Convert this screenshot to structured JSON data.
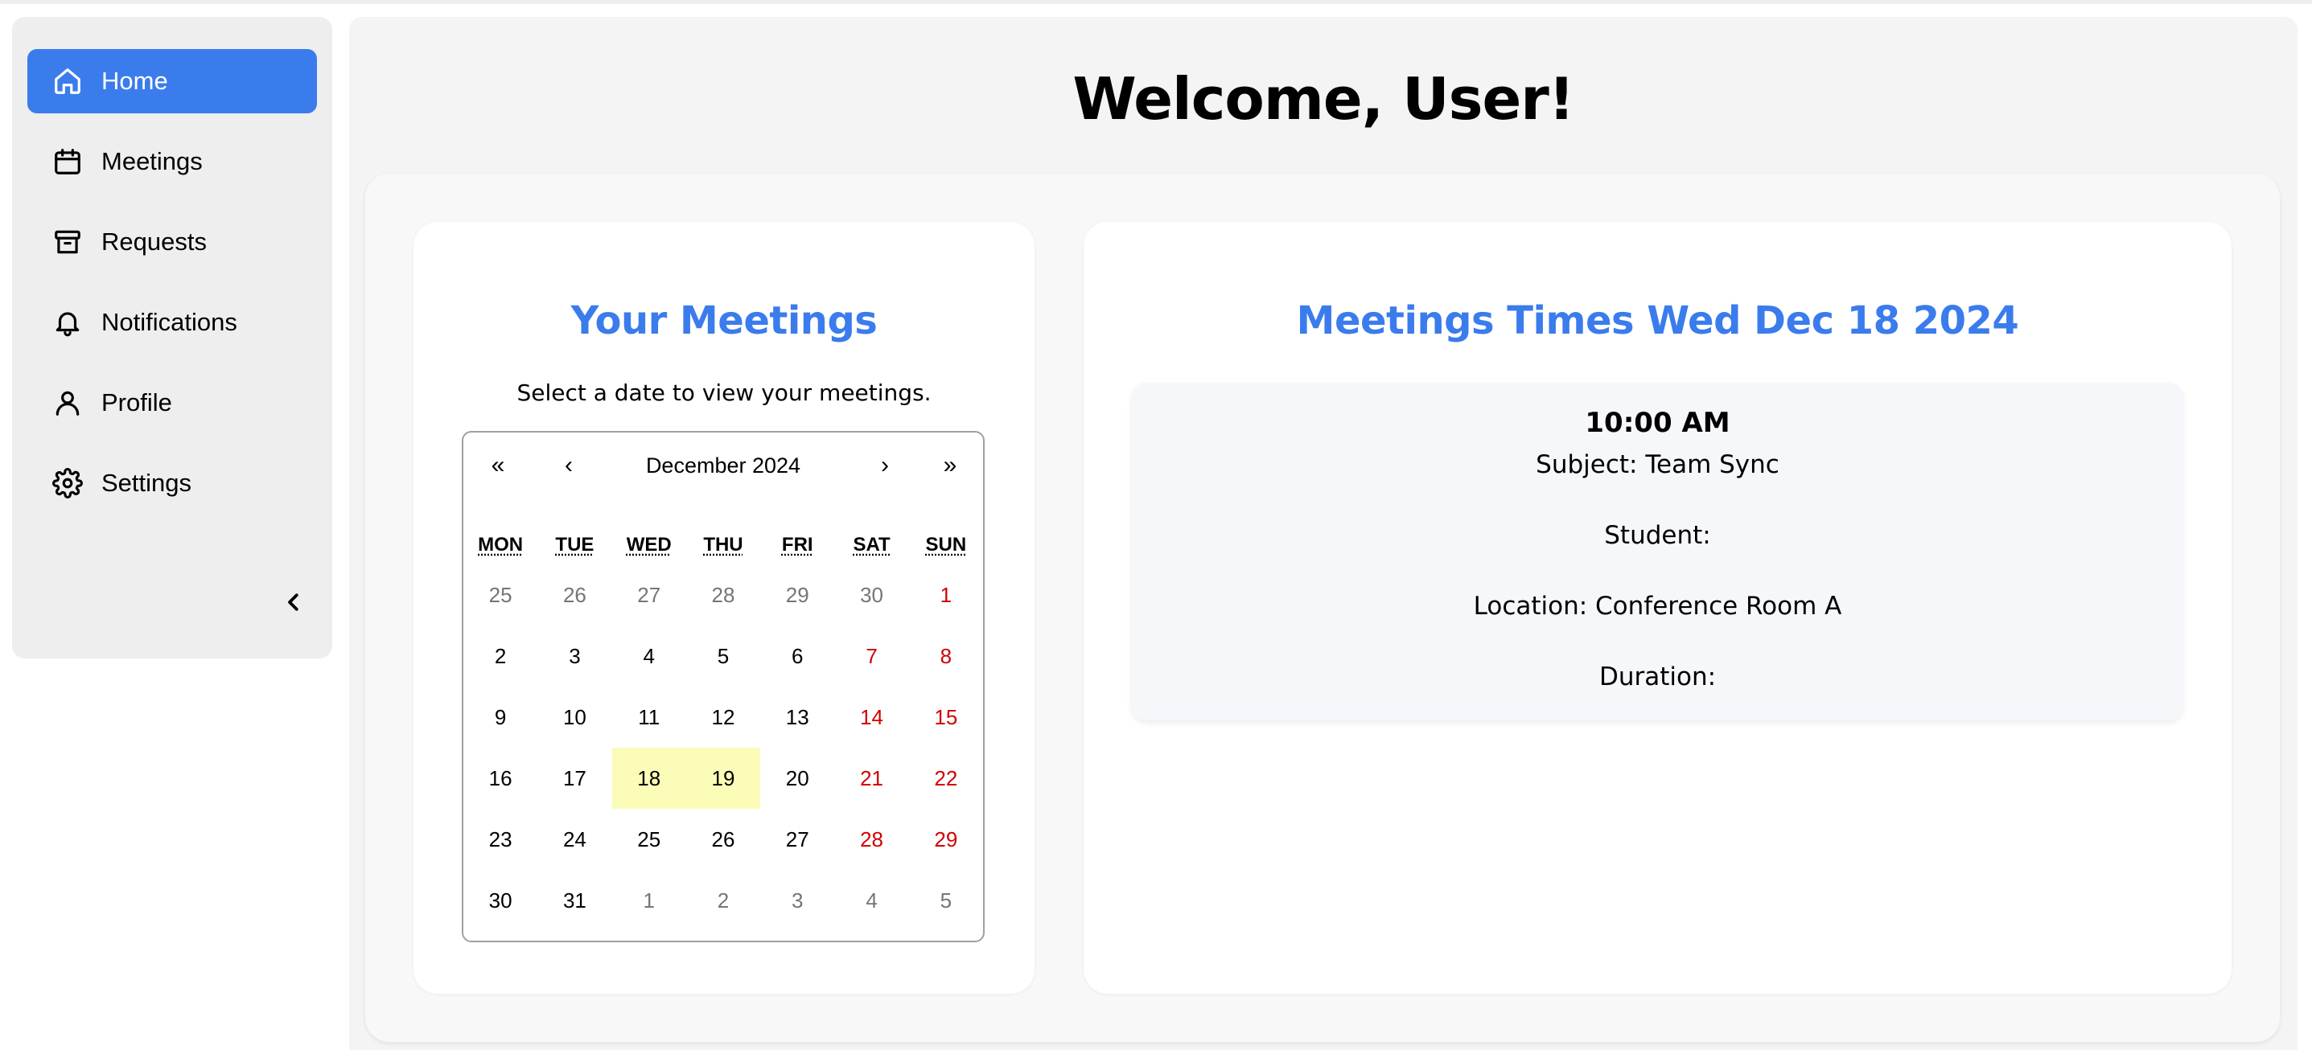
{
  "sidebar": {
    "items": [
      {
        "label": "Home",
        "icon": "home-icon"
      },
      {
        "label": "Meetings",
        "icon": "calendar-icon"
      },
      {
        "label": "Requests",
        "icon": "archive-icon"
      },
      {
        "label": "Notifications",
        "icon": "bell-icon"
      },
      {
        "label": "Profile",
        "icon": "user-icon"
      },
      {
        "label": "Settings",
        "icon": "gear-icon"
      }
    ],
    "active": "Home",
    "collapse_icon": "chevron-left-icon"
  },
  "header": {
    "welcome": "Welcome, User!"
  },
  "left_card": {
    "title": "Your Meetings",
    "subtitle": "Select a date to view your meetings."
  },
  "calendar": {
    "nav": {
      "first": "«",
      "prev": "‹",
      "month": "December 2024",
      "next": "›",
      "last": "»"
    },
    "weekdays": [
      "MON",
      "TUE",
      "WED",
      "THU",
      "FRI",
      "SAT",
      "SUN"
    ],
    "weeks": [
      [
        "25",
        "26",
        "27",
        "28",
        "29",
        "30",
        "1"
      ],
      [
        "2",
        "3",
        "4",
        "5",
        "6",
        "7",
        "8"
      ],
      [
        "9",
        "10",
        "11",
        "12",
        "13",
        "14",
        "15"
      ],
      [
        "16",
        "17",
        "18",
        "19",
        "20",
        "21",
        "22"
      ],
      [
        "23",
        "24",
        "25",
        "26",
        "27",
        "28",
        "29"
      ],
      [
        "30",
        "31",
        "1",
        "2",
        "3",
        "4",
        "5"
      ]
    ],
    "highlighted": [
      "18",
      "19"
    ],
    "weekend_color": "#d10000",
    "highlight_color": "#fbfcb7"
  },
  "right_card": {
    "title": "Meetings Times Wed Dec 18 2024",
    "meeting": {
      "time": "10:00 AM",
      "subject": "Subject: Team Sync",
      "student": "Student:",
      "location": "Location: Conference Room A",
      "duration": "Duration:"
    }
  },
  "colors": {
    "accent": "#3b7ced",
    "sidebar_bg": "#eeeeee",
    "main_bg": "#f4f4f4"
  }
}
